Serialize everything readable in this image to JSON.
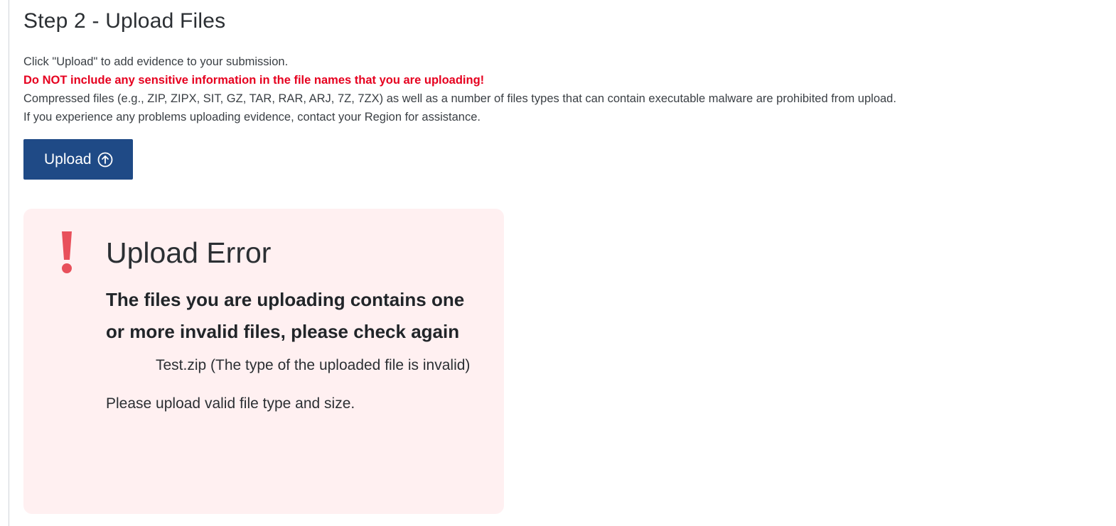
{
  "step": {
    "title": "Step 2 - Upload Files"
  },
  "instructions": {
    "line1": "Click \"Upload\" to add evidence to your submission.",
    "warning": "Do NOT include any sensitive information in the file names that you are uploading!",
    "line3": "Compressed files (e.g., ZIP, ZIPX, SIT, GZ, TAR, RAR, ARJ, 7Z, 7ZX) as well as a number of files types that can contain executable malware are prohibited from upload.",
    "line4": "If you experience any problems uploading evidence, contact your Region for assistance."
  },
  "upload_button": {
    "label": "Upload",
    "icon": "arrow-up-circle-icon"
  },
  "error": {
    "icon": "exclamation-icon",
    "title": "Upload Error",
    "message": "The files you are uploading contains one or more invalid files, please check again",
    "file": "Test.zip (The type of the uploaded file is invalid)",
    "hint": "Please upload valid file type and size."
  },
  "colors": {
    "button_bg": "#1f4a86",
    "warning_text": "#e6001f",
    "error_bg": "#fff0f1",
    "error_icon": "#e8505b"
  }
}
